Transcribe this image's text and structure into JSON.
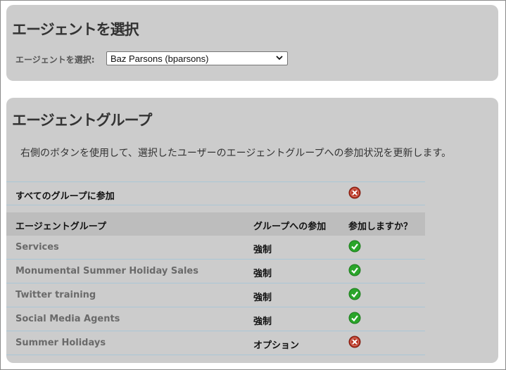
{
  "select_panel": {
    "title": "エージェントを選択",
    "label": "エージェントを選択:",
    "selected_agent": "Baz Parsons (bparsons)"
  },
  "groups_panel": {
    "title": "エージェントグループ",
    "description": "右側のボタンを使用して、選択したユーザーのエージェントグループへの参加状況を更新します。",
    "join_all": {
      "label": "すべてのグループに参加",
      "status": "no",
      "icon": "red-x-icon"
    },
    "columns": [
      "エージェントグループ",
      "グループへの参加",
      "参加しますか？"
    ],
    "rows": [
      {
        "name": "Services",
        "membership": "強制",
        "status": "yes",
        "icon": "green-check-icon"
      },
      {
        "name": "Monumental Summer Holiday Sales",
        "membership": "強制",
        "status": "yes",
        "icon": "green-check-icon"
      },
      {
        "name": "Twitter training",
        "membership": "強制",
        "status": "yes",
        "icon": "green-check-icon"
      },
      {
        "name": "Social Media Agents",
        "membership": "強制",
        "status": "yes",
        "icon": "green-check-icon"
      },
      {
        "name": "Summer Holidays",
        "membership": "オプション",
        "status": "no",
        "icon": "red-x-icon"
      }
    ]
  },
  "colors": {
    "panel_bg": "#cccccc",
    "header_bg": "#bdbdbd",
    "row_divider": "#a9c6d6",
    "check_green": "#2aa52a",
    "x_red": "#c0392b"
  }
}
